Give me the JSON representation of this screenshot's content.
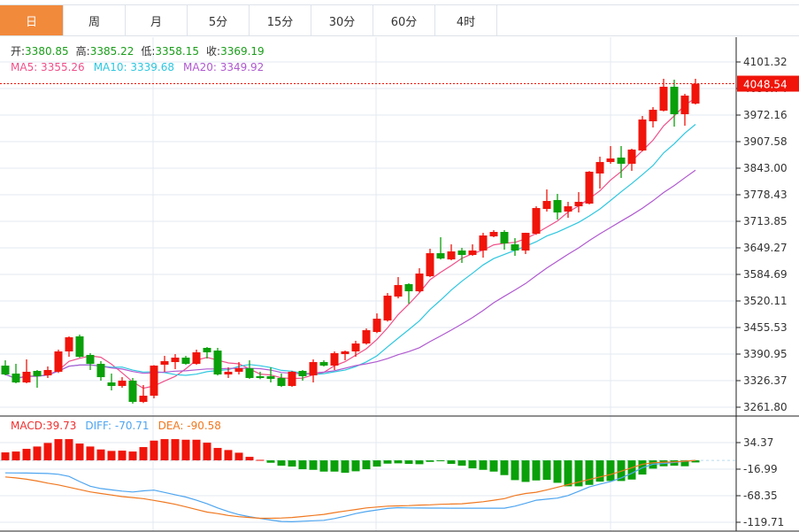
{
  "tabs": [
    {
      "label": "日",
      "active": true
    },
    {
      "label": "周"
    },
    {
      "label": "月"
    },
    {
      "label": "5分"
    },
    {
      "label": "15分"
    },
    {
      "label": "30分"
    },
    {
      "label": "60分"
    },
    {
      "label": "4时"
    }
  ],
  "ohlc_legend": {
    "open_label": "开:",
    "open": "3380.85",
    "high_label": "高:",
    "high": "3385.22",
    "low_label": "低:",
    "low": "3358.15",
    "close_label": "收:",
    "close": "3369.19"
  },
  "ma_legend": {
    "ma5": "MA5: 3355.26",
    "ma10": "MA10: 3339.68",
    "ma20": "MA20: 3349.92"
  },
  "macd_legend": {
    "macd": "MACD:39.73",
    "diff": "DIFF: -70.71",
    "dea": "DEA: -90.58"
  },
  "colors": {
    "up": "#f0140a",
    "down": "#0aa00a",
    "active_tab": "#f28a3c",
    "ma5": "#f0508a",
    "ma10": "#2ec7e0",
    "ma20": "#b05ad0",
    "macd": "#f03030",
    "diff": "#4ea5f0",
    "dea": "#f07820"
  },
  "chart_data": [
    {
      "type": "candlestick",
      "title": "",
      "ylim": [
        3261.8,
        4101.32
      ],
      "y_ticks": [
        "4101.32",
        "4036.74",
        "3972.16",
        "3907.58",
        "3843.00",
        "3778.43",
        "3713.85",
        "3649.27",
        "3584.69",
        "3520.11",
        "3455.53",
        "3390.95",
        "3326.37",
        "3261.80"
      ],
      "last_price": "4048.54",
      "grid": true,
      "ohlc": [
        [
          3362.9,
          3375.8,
          3339.2,
          3341.4
        ],
        [
          3343.5,
          3367.2,
          3319.9,
          3322.0
        ],
        [
          3322.0,
          3378.0,
          3320.0,
          3347.9
        ],
        [
          3350.0,
          3352.2,
          3309.1,
          3337.1
        ],
        [
          3339.2,
          3360.8,
          3332.8,
          3352.2
        ],
        [
          3347.9,
          3401.7,
          3345.0,
          3397.4
        ],
        [
          3397.4,
          3434.0,
          3384.4,
          3431.8
        ],
        [
          3434.0,
          3438.3,
          3382.0,
          3384.4
        ],
        [
          3388.8,
          3393.1,
          3352.2,
          3367.2
        ],
        [
          3367.2,
          3373.7,
          3326.3,
          3334.9
        ],
        [
          3322.0,
          3343.5,
          3302.6,
          3313.4
        ],
        [
          3313.4,
          3334.9,
          3309.1,
          3326.3
        ],
        [
          3326.3,
          3332.8,
          3270.4,
          3274.7
        ],
        [
          3274.7,
          3315.6,
          3272.0,
          3289.7
        ],
        [
          3289.7,
          3364.0,
          3283.3,
          3362.9
        ],
        [
          3365.1,
          3386.6,
          3347.9,
          3373.7
        ],
        [
          3371.5,
          3390.9,
          3354.3,
          3382.3
        ],
        [
          3382.3,
          3386.6,
          3365.1,
          3367.2
        ],
        [
          3367.2,
          3401.7,
          3365.1,
          3395.2
        ],
        [
          3406.0,
          3408.1,
          3380.1,
          3395.2
        ],
        [
          3399.5,
          3406.0,
          3339.0,
          3341.4
        ],
        [
          3341.4,
          3358.6,
          3332.8,
          3347.9
        ],
        [
          3347.9,
          3371.5,
          3341.4,
          3356.5
        ],
        [
          3356.5,
          3375.8,
          3330.6,
          3332.8
        ],
        [
          3337.1,
          3347.9,
          3330.0,
          3332.8
        ],
        [
          3337.1,
          3358.6,
          3322.0,
          3330.6
        ],
        [
          3332.8,
          3343.5,
          3311.0,
          3313.4
        ],
        [
          3313.4,
          3350.0,
          3311.3,
          3347.9
        ],
        [
          3350.0,
          3352.2,
          3326.3,
          3337.1
        ],
        [
          3339.2,
          3378.0,
          3322.0,
          3371.5
        ],
        [
          3371.5,
          3375.8,
          3360.8,
          3362.9
        ],
        [
          3362.9,
          3397.4,
          3352.2,
          3393.1
        ],
        [
          3390.9,
          3399.5,
          3375.8,
          3397.4
        ],
        [
          3397.4,
          3423.2,
          3384.4,
          3416.7
        ],
        [
          3416.7,
          3453.3,
          3414.0,
          3449.0
        ],
        [
          3444.7,
          3489.9,
          3442.0,
          3477.0
        ],
        [
          3472.7,
          3539.4,
          3470.0,
          3533.0
        ],
        [
          3530.8,
          3578.2,
          3526.5,
          3558.8
        ],
        [
          3561.0,
          3563.0,
          3513.6,
          3543.7
        ],
        [
          3543.7,
          3599.7,
          3541.0,
          3586.8
        ],
        [
          3580.3,
          3647.1,
          3578.0,
          3636.3
        ],
        [
          3636.3,
          3675.1,
          3621.0,
          3623.4
        ],
        [
          3621.2,
          3657.8,
          3619.0,
          3640.6
        ],
        [
          3642.8,
          3649.2,
          3612.6,
          3632.0
        ],
        [
          3632.0,
          3657.8,
          3629.9,
          3642.8
        ],
        [
          3642.8,
          3685.8,
          3625.5,
          3679.4
        ],
        [
          3677.2,
          3692.3,
          3675.1,
          3688.0
        ],
        [
          3688.0,
          3692.3,
          3644.9,
          3660.0
        ],
        [
          3657.8,
          3672.9,
          3629.9,
          3642.8
        ],
        [
          3642.8,
          3686.0,
          3634.2,
          3685.8
        ],
        [
          3683.7,
          3750.4,
          3681.0,
          3746.1
        ],
        [
          3743.9,
          3791.3,
          3737.5,
          3763.3
        ],
        [
          3765.5,
          3780.5,
          3718.1,
          3735.3
        ],
        [
          3737.5,
          3761.2,
          3722.4,
          3750.4
        ],
        [
          3750.4,
          3784.8,
          3735.3,
          3761.2
        ],
        [
          3756.9,
          3836.0,
          3755.0,
          3834.4
        ],
        [
          3830.1,
          3871.0,
          3793.5,
          3858.0
        ],
        [
          3858.0,
          3896.8,
          3853.7,
          3866.6
        ],
        [
          3868.8,
          3896.8,
          3819.3,
          3853.7
        ],
        [
          3853.7,
          3890.3,
          3836.5,
          3888.2
        ],
        [
          3886.0,
          3970.0,
          3884.0,
          3961.4
        ],
        [
          3957.1,
          3991.5,
          3942.0,
          3985.1
        ],
        [
          3982.9,
          4060.4,
          3981.0,
          4041.0
        ],
        [
          4041.0,
          4058.2,
          3944.1,
          3974.3
        ],
        [
          3974.3,
          4023.8,
          3946.3,
          4019.5
        ],
        [
          4000.1,
          4060.4,
          3998.0,
          4048.54
        ]
      ],
      "ma_periods": [
        5,
        10,
        20
      ]
    },
    {
      "type": "bar+line",
      "title": "",
      "ylim": [
        -119.71,
        34.37
      ],
      "y_ticks": [
        "34.37",
        "-16.99",
        "-68.35",
        "-119.71"
      ],
      "macd": [
        15.4,
        17.1,
        22.3,
        26.8,
        33.7,
        41.1,
        41.1,
        32.5,
        26.8,
        21.1,
        18.3,
        18.8,
        17.1,
        25.7,
        38.2,
        41.1,
        41.1,
        39.9,
        39.9,
        34.2,
        24.0,
        20.0,
        14.8,
        6.8,
        1.0,
        -4.6,
        -10.3,
        -12.0,
        -17.1,
        -18.3,
        -21.7,
        -21.7,
        -24.0,
        -21.1,
        -17.1,
        -12.0,
        -6.3,
        -5.7,
        -6.8,
        -7.4,
        -2.9,
        -1.7,
        -6.8,
        -10.3,
        -15.4,
        -18.3,
        -21.7,
        -28.5,
        -38.2,
        -41.7,
        -38.8,
        -37.7,
        -43.4,
        -50.2,
        -50.2,
        -47.4,
        -41.1,
        -39.9,
        -39.9,
        -37.1,
        -27.4,
        -16.0,
        -11.4,
        -10.3,
        -11.4,
        -4.0
      ],
      "diff": [
        -24.2,
        -24.4,
        -24.6,
        -24.9,
        -25.3,
        -27,
        -31,
        -41,
        -50,
        -54.5,
        -57,
        -59.5,
        -61.1,
        -59,
        -57.5,
        -62,
        -66.5,
        -71,
        -77,
        -84,
        -92,
        -99,
        -105,
        -109,
        -112.4,
        -115.5,
        -118.2,
        -118.6,
        -117.7,
        -116.8,
        -115.9,
        -112.5,
        -108,
        -103,
        -99,
        -95.9,
        -93,
        -91.5,
        -92,
        -92.2,
        -92.3,
        -92.4,
        -92.5,
        -92.5,
        -92.5,
        -92.5,
        -92.5,
        -92.5,
        -88.5,
        -83,
        -77,
        -75,
        -73,
        -68,
        -60,
        -51.4,
        -46,
        -41.1,
        -34,
        -25,
        -14.3,
        -7.4,
        -6,
        -4,
        -2,
        0
      ],
      "dea": [
        -32,
        -34,
        -36.5,
        -40,
        -44,
        -47.4,
        -52,
        -56.5,
        -61,
        -64,
        -67,
        -70,
        -72,
        -74,
        -77.5,
        -81,
        -85,
        -90,
        -95,
        -100,
        -103,
        -106.5,
        -109,
        -110.5,
        -112,
        -112,
        -111.5,
        -110.5,
        -108.5,
        -106.5,
        -104.4,
        -101,
        -98,
        -95,
        -92,
        -90.2,
        -88.5,
        -88,
        -87.5,
        -86.5,
        -86,
        -85,
        -84.5,
        -84,
        -82,
        -80,
        -77,
        -74,
        -68,
        -64,
        -61.6,
        -57,
        -52,
        -47,
        -42,
        -37,
        -32,
        -27.4,
        -21,
        -14.3,
        -7.4,
        -4.6,
        -3.5,
        -2.9,
        -1.5,
        0
      ]
    }
  ]
}
